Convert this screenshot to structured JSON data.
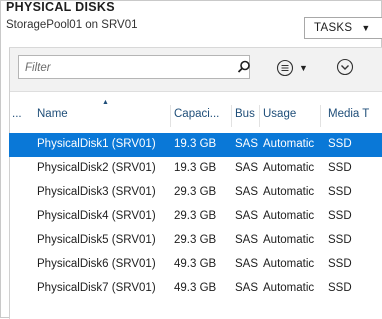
{
  "header": {
    "title": "PHYSICAL DISKS",
    "subtitle": "StoragePool01 on SRV01",
    "tasks_label": "TASKS"
  },
  "filter": {
    "placeholder": "Filter"
  },
  "icons": {
    "search": "search-icon",
    "view": "list-view-icon",
    "expand": "chevron-down-circle-icon"
  },
  "columns": [
    "...",
    "Name",
    "Capaci...",
    "Bus",
    "Usage",
    "Media T"
  ],
  "rows": [
    {
      "name": "PhysicalDisk1 (SRV01)",
      "capacity": "19.3 GB",
      "bus": "SAS",
      "usage": "Automatic",
      "media": "SSD",
      "selected": true
    },
    {
      "name": "PhysicalDisk2 (SRV01)",
      "capacity": "19.3 GB",
      "bus": "SAS",
      "usage": "Automatic",
      "media": "SSD",
      "selected": false
    },
    {
      "name": "PhysicalDisk3 (SRV01)",
      "capacity": "29.3 GB",
      "bus": "SAS",
      "usage": "Automatic",
      "media": "SSD",
      "selected": false
    },
    {
      "name": "PhysicalDisk4 (SRV01)",
      "capacity": "29.3 GB",
      "bus": "SAS",
      "usage": "Automatic",
      "media": "SSD",
      "selected": false
    },
    {
      "name": "PhysicalDisk5 (SRV01)",
      "capacity": "29.3 GB",
      "bus": "SAS",
      "usage": "Automatic",
      "media": "SSD",
      "selected": false
    },
    {
      "name": "PhysicalDisk6 (SRV01)",
      "capacity": "49.3 GB",
      "bus": "SAS",
      "usage": "Automatic",
      "media": "SSD",
      "selected": false
    },
    {
      "name": "PhysicalDisk7 (SRV01)",
      "capacity": "49.3 GB",
      "bus": "SAS",
      "usage": "Automatic",
      "media": "SSD",
      "selected": false
    }
  ],
  "colors": {
    "selection": "#0a78d7",
    "header_text": "#1f4e79"
  }
}
